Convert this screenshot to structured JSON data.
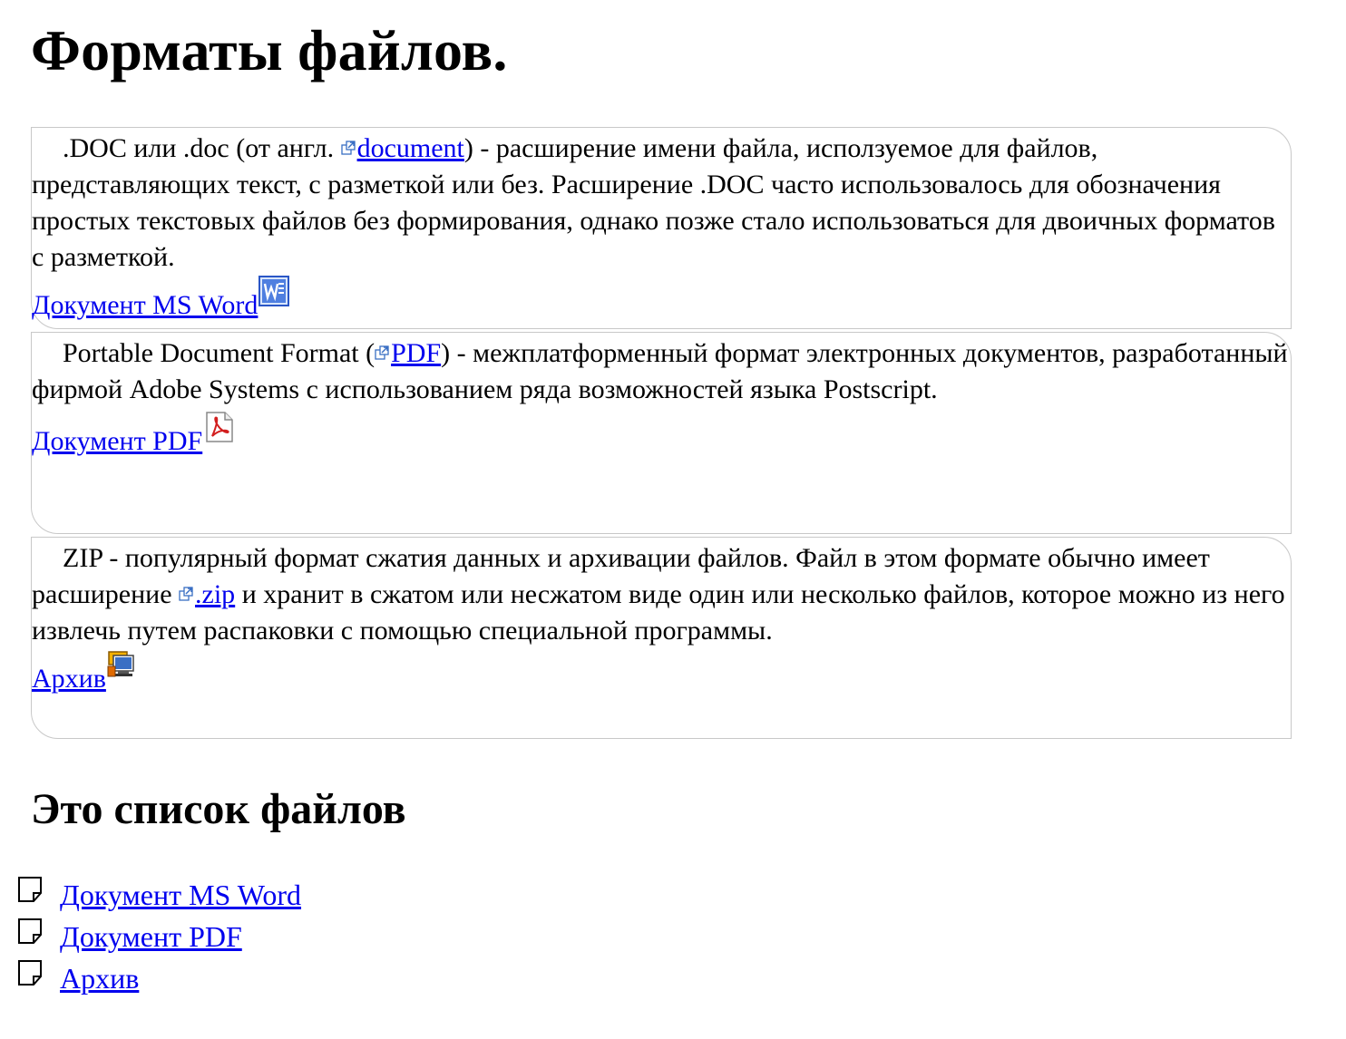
{
  "page": {
    "title": "Форматы файлов."
  },
  "formats": [
    {
      "prefix": ".DOC или .doc (от англ. ",
      "ext_link": "document",
      "suffix": ") - расширение имени файла, исползуемое для файлов, представляющих текст, с разметкой или без. Расширение .DOC часто использовалось для обозначения простых текстовых файлов без формирования, однако позже стало использоваться для двоичных форматов с разметкой.",
      "doc_link": "Документ MS Word",
      "icon": "ms-word-icon"
    },
    {
      "prefix": "Portable Document Format (",
      "ext_link": "PDF",
      "suffix": ") - межплатформенный формат электронных документов, разработанный фирмой Adobe Systems с использованием ряда возможностей языка Postscript.",
      "doc_link": "Документ PDF",
      "icon": "pdf-icon"
    },
    {
      "prefix": "ZIP - популярный формат сжатия данных и архивации файлов. Файл в этом формате обычно имеет расширение ",
      "ext_link": ".zip",
      "suffix": " и хранит в сжатом или несжатом виде один или несколько файлов, которое можно из него извлечь путем распаковки с помощью специальной программы.",
      "doc_link": "Архив",
      "icon": "archive-icon"
    }
  ],
  "file_list": {
    "heading": "Это список файлов",
    "items": [
      {
        "label": "Документ MS Word",
        "icon": "document-icon"
      },
      {
        "label": "Документ PDF",
        "icon": "document-icon"
      },
      {
        "label": "Архив",
        "icon": "document-icon"
      }
    ]
  }
}
